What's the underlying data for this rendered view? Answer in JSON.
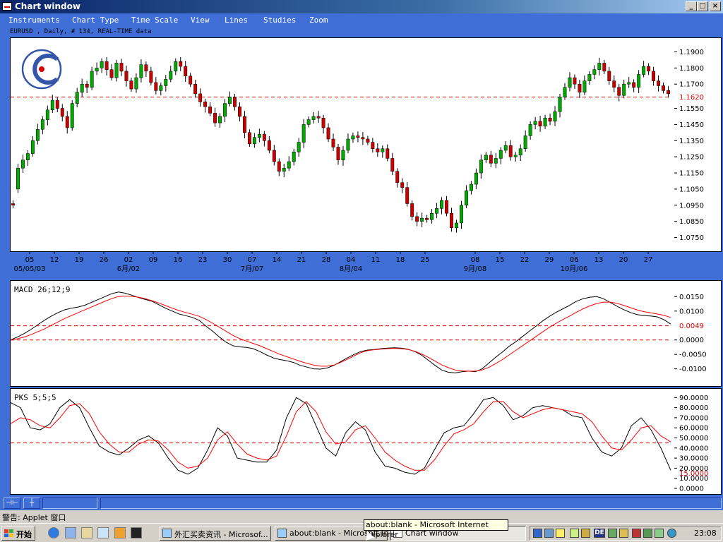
{
  "window": {
    "title": "Chart window",
    "minimize_glyph": "_",
    "maximize_glyph": "□",
    "close_glyph": "×"
  },
  "menu": [
    "Instruments",
    "Chart Type",
    "Time Scale",
    "View",
    "Lines",
    "Studies",
    "Zoom"
  ],
  "instrument_label": "EURUSD , Daily, # 134, REAL-TIME data",
  "colors": {
    "window_background": "#3f6fd6",
    "bull_candle": "#00aa00",
    "bear_candle": "#cc0000",
    "indicator_line": "#000000",
    "signal_line": "#ff0000",
    "reference_line": "#dd0000"
  },
  "chart_data": [
    {
      "type": "candlestick",
      "price_labels": [
        "1.1900",
        "1.1800",
        "1.1700",
        "1.1550",
        "1.1450",
        "1.1350",
        "1.1250",
        "1.1150",
        "1.1050",
        "1.0950",
        "1.0850",
        "1.0750"
      ],
      "reference_label": "1.1620",
      "reference_value": 1.162,
      "ylim": [
        1.07,
        1.195
      ],
      "x_tick_labels": [
        "05",
        "12",
        "19",
        "26",
        "02",
        "09",
        "16",
        "23",
        "30",
        "07",
        "14",
        "21",
        "28",
        "04",
        "11",
        "18",
        "25",
        "08",
        "15",
        "22",
        "29",
        "06",
        "13",
        "20",
        "27"
      ],
      "x_month_labels": [
        "05/05/03",
        "6月/02",
        "7月/07",
        "8月/04",
        "9月/08",
        "10月/06"
      ],
      "close": [
        1.095,
        1.118,
        1.123,
        1.127,
        1.135,
        1.142,
        1.148,
        1.154,
        1.16,
        1.155,
        1.15,
        1.143,
        1.158,
        1.165,
        1.17,
        1.168,
        1.178,
        1.18,
        1.184,
        1.179,
        1.174,
        1.183,
        1.178,
        1.172,
        1.167,
        1.174,
        1.182,
        1.178,
        1.171,
        1.166,
        1.169,
        1.173,
        1.178,
        1.184,
        1.181,
        1.175,
        1.17,
        1.164,
        1.159,
        1.156,
        1.152,
        1.146,
        1.15,
        1.158,
        1.162,
        1.156,
        1.15,
        1.14,
        1.133,
        1.137,
        1.139,
        1.135,
        1.129,
        1.122,
        1.116,
        1.118,
        1.122,
        1.128,
        1.134,
        1.145,
        1.148,
        1.15,
        1.149,
        1.143,
        1.136,
        1.131,
        1.123,
        1.129,
        1.136,
        1.138,
        1.137,
        1.136,
        1.134,
        1.13,
        1.128,
        1.13,
        1.124,
        1.116,
        1.109,
        1.106,
        1.096,
        1.088,
        1.085,
        1.087,
        1.086,
        1.09,
        1.093,
        1.098,
        1.09,
        1.081,
        1.084,
        1.095,
        1.104,
        1.108,
        1.115,
        1.123,
        1.126,
        1.121,
        1.124,
        1.129,
        1.132,
        1.125,
        1.126,
        1.13,
        1.138,
        1.145,
        1.147,
        1.144,
        1.149,
        1.147,
        1.153,
        1.162,
        1.168,
        1.174,
        1.17,
        1.165,
        1.172,
        1.176,
        1.179,
        1.183,
        1.178,
        1.172,
        1.168,
        1.163,
        1.17,
        1.171,
        1.168,
        1.176,
        1.181,
        1.178,
        1.172,
        1.169,
        1.166,
        1.164
      ],
      "open": [
        1.096,
        1.105,
        1.118,
        1.123,
        1.127,
        1.135,
        1.142,
        1.148,
        1.154,
        1.16,
        1.155,
        1.15,
        1.143,
        1.158,
        1.165,
        1.17,
        1.168,
        1.178,
        1.18,
        1.184,
        1.179,
        1.174,
        1.183,
        1.178,
        1.172,
        1.167,
        1.174,
        1.182,
        1.178,
        1.171,
        1.166,
        1.169,
        1.173,
        1.178,
        1.184,
        1.181,
        1.175,
        1.17,
        1.164,
        1.159,
        1.156,
        1.152,
        1.146,
        1.15,
        1.158,
        1.162,
        1.156,
        1.15,
        1.14,
        1.133,
        1.137,
        1.139,
        1.135,
        1.129,
        1.122,
        1.116,
        1.118,
        1.122,
        1.128,
        1.134,
        1.145,
        1.148,
        1.15,
        1.149,
        1.143,
        1.136,
        1.131,
        1.123,
        1.129,
        1.136,
        1.138,
        1.137,
        1.136,
        1.134,
        1.13,
        1.128,
        1.13,
        1.124,
        1.116,
        1.109,
        1.106,
        1.096,
        1.088,
        1.085,
        1.087,
        1.086,
        1.09,
        1.093,
        1.098,
        1.09,
        1.081,
        1.084,
        1.095,
        1.104,
        1.108,
        1.115,
        1.123,
        1.126,
        1.121,
        1.124,
        1.129,
        1.132,
        1.125,
        1.126,
        1.13,
        1.138,
        1.145,
        1.147,
        1.144,
        1.149,
        1.147,
        1.153,
        1.162,
        1.168,
        1.174,
        1.17,
        1.165,
        1.172,
        1.176,
        1.179,
        1.183,
        1.178,
        1.172,
        1.168,
        1.163,
        1.17,
        1.171,
        1.168,
        1.176,
        1.181,
        1.178,
        1.172,
        1.169,
        1.166
      ]
    },
    {
      "type": "line",
      "label": "MACD 26;12;9",
      "y_tick_labels": [
        "0.0150",
        "0.0100",
        "0.0000",
        "-0.0050",
        "-0.0100"
      ],
      "reference_label": "0.0049",
      "reference_value": 0.0049,
      "ylim": [
        -0.014,
        0.0185
      ],
      "series": [
        {
          "values": [
            0.0,
            0.001,
            0.0022,
            0.0036,
            0.0052,
            0.0068,
            0.0082,
            0.0094,
            0.0104,
            0.011,
            0.0114,
            0.012,
            0.013,
            0.014,
            0.015,
            0.016,
            0.0166,
            0.0162,
            0.0155,
            0.0147,
            0.014,
            0.0134,
            0.0122,
            0.011,
            0.01,
            0.009,
            0.0084,
            0.0078,
            0.0068,
            0.0048,
            0.003,
            0.001,
            -0.0008,
            -0.002,
            -0.0024,
            -0.0026,
            -0.003,
            -0.004,
            -0.0052,
            -0.0062,
            -0.0068,
            -0.0072,
            -0.0078,
            -0.0088,
            -0.0094,
            -0.01,
            -0.0101,
            -0.0097,
            -0.0088,
            -0.0075,
            -0.0062,
            -0.005,
            -0.004,
            -0.0035,
            -0.0033,
            -0.003,
            -0.0028,
            -0.0027,
            -0.0028,
            -0.0032,
            -0.004,
            -0.0052,
            -0.007,
            -0.0088,
            -0.0104,
            -0.0112,
            -0.0114,
            -0.011,
            -0.0108,
            -0.011,
            -0.01,
            -0.008,
            -0.006,
            -0.0042,
            -0.0022,
            -0.0006,
            0.0012,
            0.003,
            0.0048,
            0.0066,
            0.0082,
            0.0096,
            0.0108,
            0.012,
            0.0134,
            0.0143,
            0.0148,
            0.015,
            0.0143,
            0.013,
            0.0117,
            0.0105,
            0.0095,
            0.0088,
            0.0084,
            0.0083,
            0.008,
            0.007,
            0.0055
          ]
        },
        {
          "values": [
            0.0,
            0.0004,
            0.001,
            0.0018,
            0.0028,
            0.0038,
            0.005,
            0.0062,
            0.0074,
            0.0084,
            0.0094,
            0.0104,
            0.0114,
            0.0124,
            0.0134,
            0.0143,
            0.015,
            0.0152,
            0.0151,
            0.0148,
            0.0143,
            0.0136,
            0.0128,
            0.0119,
            0.011,
            0.0102,
            0.0095,
            0.0089,
            0.0082,
            0.0071,
            0.0058,
            0.0044,
            0.003,
            0.0016,
            0.0005,
            -0.0004,
            -0.0012,
            -0.002,
            -0.003,
            -0.004,
            -0.005,
            -0.0058,
            -0.0066,
            -0.0074,
            -0.0081,
            -0.0087,
            -0.0091,
            -0.0091,
            -0.0087,
            -0.0078,
            -0.0067,
            -0.0055,
            -0.0044,
            -0.0037,
            -0.0034,
            -0.0032,
            -0.003,
            -0.0029,
            -0.003,
            -0.0033,
            -0.0039,
            -0.0048,
            -0.006,
            -0.0073,
            -0.0086,
            -0.0096,
            -0.0104,
            -0.0107,
            -0.0108,
            -0.0108,
            -0.0104,
            -0.0095,
            -0.0082,
            -0.0068,
            -0.0052,
            -0.0036,
            -0.002,
            -0.0004,
            0.0012,
            0.0028,
            0.0044,
            0.0058,
            0.0071,
            0.0083,
            0.0096,
            0.0108,
            0.0118,
            0.0126,
            0.0131,
            0.0131,
            0.0127,
            0.012,
            0.0112,
            0.0104,
            0.0098,
            0.0094,
            0.009,
            0.0085,
            0.0078
          ]
        }
      ]
    },
    {
      "type": "line",
      "label": "PKS 5;5;5",
      "y_tick_labels": [
        "90.0000",
        "80.0000",
        "70.0000",
        "60.0000",
        "50.0000",
        "40.0000",
        "30.0000",
        "20.0000",
        "10.0000",
        "0.0000"
      ],
      "reference_label": "15.0000",
      "ylim": [
        0,
        93
      ],
      "reference_value": 45,
      "series": [
        {
          "values": [
            85,
            80,
            60,
            58,
            64,
            80,
            88,
            80,
            60,
            42,
            36,
            33,
            40,
            48,
            52,
            45,
            30,
            18,
            14,
            20,
            38,
            60,
            52,
            30,
            28,
            26,
            26,
            38,
            70,
            90,
            84,
            62,
            40,
            32,
            55,
            66,
            58,
            36,
            22,
            20,
            16,
            14,
            20,
            38,
            55,
            60,
            62,
            74,
            88,
            90,
            82,
            68,
            72,
            80,
            82,
            80,
            78,
            72,
            70,
            50,
            36,
            32,
            40,
            62,
            70,
            58,
            40,
            18
          ]
        },
        {
          "values": [
            64,
            70,
            68,
            62,
            60,
            70,
            82,
            84,
            74,
            56,
            44,
            36,
            36,
            44,
            48,
            47,
            38,
            26,
            20,
            22,
            30,
            48,
            56,
            44,
            34,
            30,
            28,
            32,
            52,
            76,
            86,
            76,
            56,
            44,
            46,
            58,
            62,
            50,
            36,
            28,
            22,
            18,
            18,
            28,
            42,
            54,
            58,
            64,
            76,
            86,
            86,
            76,
            70,
            74,
            78,
            80,
            78,
            76,
            74,
            66,
            52,
            40,
            38,
            48,
            60,
            62,
            52,
            46
          ]
        }
      ]
    }
  ],
  "statusbar": {
    "btn1_glyph": "⊣⊢",
    "btn2_glyph": "┼"
  },
  "warning_text": "警告: Applet 窗口",
  "taskbar": {
    "start_label": "开始",
    "tasks": [
      "外汇买卖资讯 - Microsof...",
      "about:blank - Microsoft In...",
      "Chart window"
    ],
    "clock": "23:08",
    "lang": "DE"
  },
  "tooltip": "about:blank - Microsoft Internet Explorer"
}
